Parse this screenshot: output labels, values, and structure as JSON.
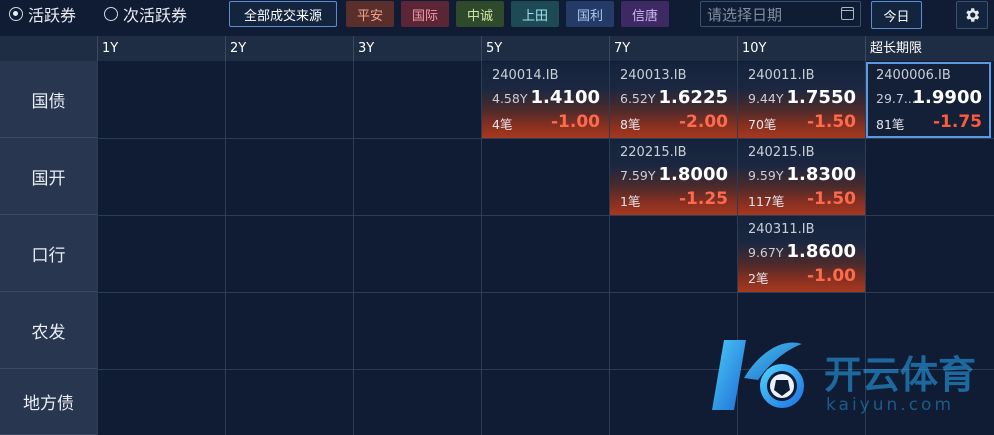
{
  "toolbar": {
    "radios": [
      {
        "label": "活跃券",
        "checked": true
      },
      {
        "label": "次活跃券",
        "checked": false
      }
    ],
    "all_sources_label": "全部成交来源",
    "brokers": [
      {
        "label": "平安",
        "bg": "#5a2f2b",
        "fg": "#f0a58e"
      },
      {
        "label": "国际",
        "bg": "#5a2534",
        "fg": "#f59aa8"
      },
      {
        "label": "中诚",
        "bg": "#2e4a2a",
        "fg": "#cfe3a4"
      },
      {
        "label": "上田",
        "bg": "#1d4a55",
        "fg": "#9fe3ef"
      },
      {
        "label": "国利",
        "bg": "#233b66",
        "fg": "#aec8f4"
      },
      {
        "label": "信唐",
        "bg": "#3e2a63",
        "fg": "#cdb3f3"
      }
    ],
    "date_placeholder": "请选择日期",
    "today_label": "今日"
  },
  "columns": [
    "1Y",
    "2Y",
    "3Y",
    "5Y",
    "7Y",
    "10Y",
    "超长期限"
  ],
  "rows": [
    "国债",
    "国开",
    "口行",
    "农发",
    "地方债"
  ],
  "quotes": [
    {
      "row": 0,
      "col": 3,
      "code": "240014.IB",
      "term": "4.58Y",
      "yield": "1.4100",
      "count": "4笔",
      "change": "-1.00",
      "selected": false
    },
    {
      "row": 0,
      "col": 4,
      "code": "240013.IB",
      "term": "6.52Y",
      "yield": "1.6225",
      "count": "8笔",
      "change": "-2.00",
      "selected": false
    },
    {
      "row": 0,
      "col": 5,
      "code": "240011.IB",
      "term": "9.44Y",
      "yield": "1.7550",
      "count": "70笔",
      "change": "-1.50",
      "selected": false
    },
    {
      "row": 0,
      "col": 6,
      "code": "2400006.IB",
      "term": "29.7...",
      "yield": "1.9900",
      "count": "81笔",
      "change": "-1.75",
      "selected": true
    },
    {
      "row": 1,
      "col": 4,
      "code": "220215.IB",
      "term": "7.59Y",
      "yield": "1.8000",
      "count": "1笔",
      "change": "-1.25",
      "selected": false
    },
    {
      "row": 1,
      "col": 5,
      "code": "240215.IB",
      "term": "9.59Y",
      "yield": "1.8300",
      "count": "117笔",
      "change": "-1.50",
      "selected": false
    },
    {
      "row": 2,
      "col": 5,
      "code": "240311.IB",
      "term": "9.67Y",
      "yield": "1.8600",
      "count": "2笔",
      "change": "-1.00",
      "selected": false
    }
  ],
  "watermark": {
    "brand": "开云体育",
    "site": "kaiyun.com"
  },
  "colors": {
    "accent": "#5b9ae0",
    "negative": "#ff6a4d",
    "background": "#0f1c33"
  }
}
